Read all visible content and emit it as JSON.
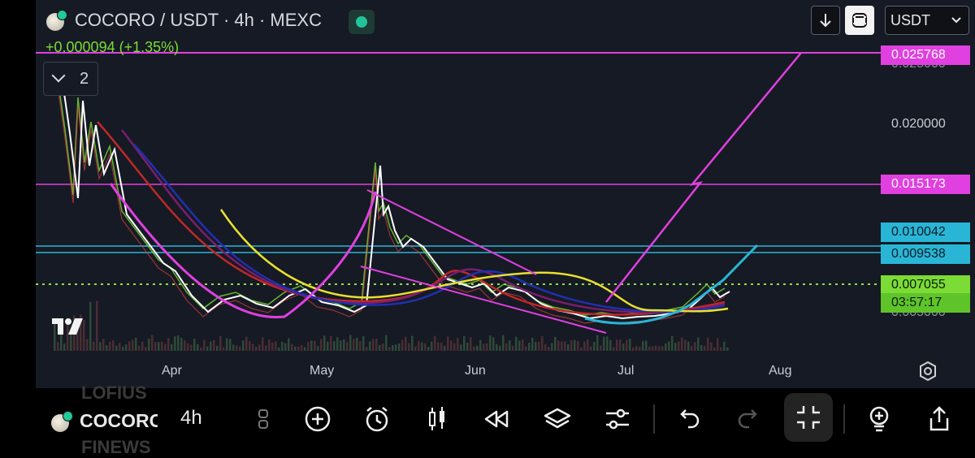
{
  "header": {
    "title": "COCORO / USDT · 4h · MEXC",
    "change": "+0.000094 (+1.35%)",
    "indicator_count": "2",
    "currency": "USDT"
  },
  "price_axis": {
    "partial_top_label": "0.025000",
    "label_020": "0.020000",
    "partial_bottom_label": "0.005000"
  },
  "price_tags": {
    "p1": "0.025768",
    "p2": "0.015173",
    "p3": "0.010042",
    "p4": "0.009538",
    "last_price": "0.007055",
    "countdown": "03:57:17"
  },
  "time_axis": [
    "Apr",
    "May",
    "Jun",
    "Jul",
    "Aug"
  ],
  "bottom_bar": {
    "ghost_top": "LOFIUS",
    "symbol": "COCORO",
    "ghost_bottom": "FINEWS",
    "timeframe": "4h"
  },
  "colors": {
    "bg": "#161a24",
    "magenta": "#e040e0",
    "cyan": "#29b6d6",
    "yellow": "#e8e030",
    "green": "#7bdc35"
  }
}
